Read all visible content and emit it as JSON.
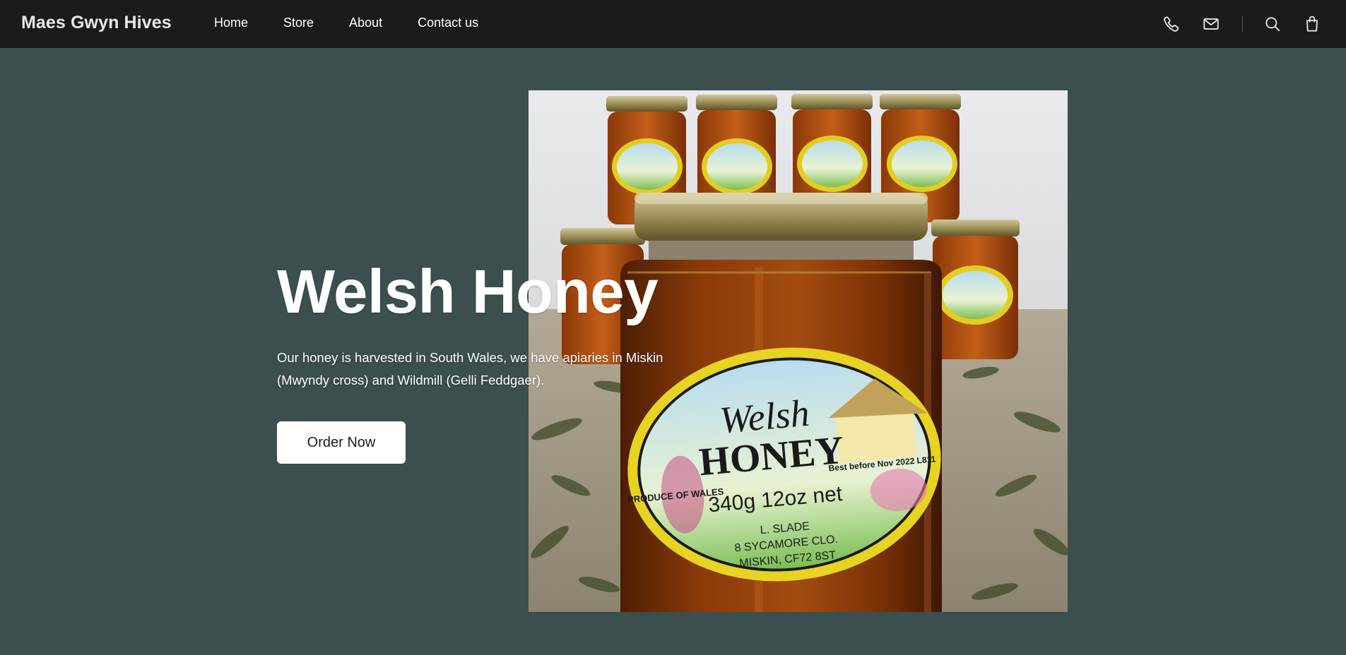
{
  "brand": {
    "name": "Maes Gwyn Hives"
  },
  "nav": {
    "items": [
      {
        "label": "Home"
      },
      {
        "label": "Store"
      },
      {
        "label": "About"
      },
      {
        "label": "Contact us"
      }
    ]
  },
  "header_icons": [
    "phone-icon",
    "mail-icon",
    "search-icon",
    "shopping-bag-icon"
  ],
  "hero": {
    "title": "Welsh Honey",
    "description": "Our honey is harvested in South Wales, we have apiaries in Miskin (Mwyndy cross) and Wildmill (Gelli Feddgaer).",
    "cta_label": "Order Now",
    "photo": {
      "label_title_1": "Welsh",
      "label_title_2": "HONEY",
      "label_produce": "PRODUCE OF WALES",
      "label_weight": "340g 12oz net",
      "label_best_before": "Best before Nov 2022 L811",
      "label_address_1": "L. SLADE",
      "label_address_2": "8 SYCAMORE CLO.",
      "label_address_3": "MISKIN, CF72 8ST"
    }
  },
  "colors": {
    "topbar": "#1b1b1b",
    "background": "#3b4f4e",
    "button_bg": "#ffffff",
    "button_text": "#1b1b1b",
    "honey": "#8a3a08"
  }
}
